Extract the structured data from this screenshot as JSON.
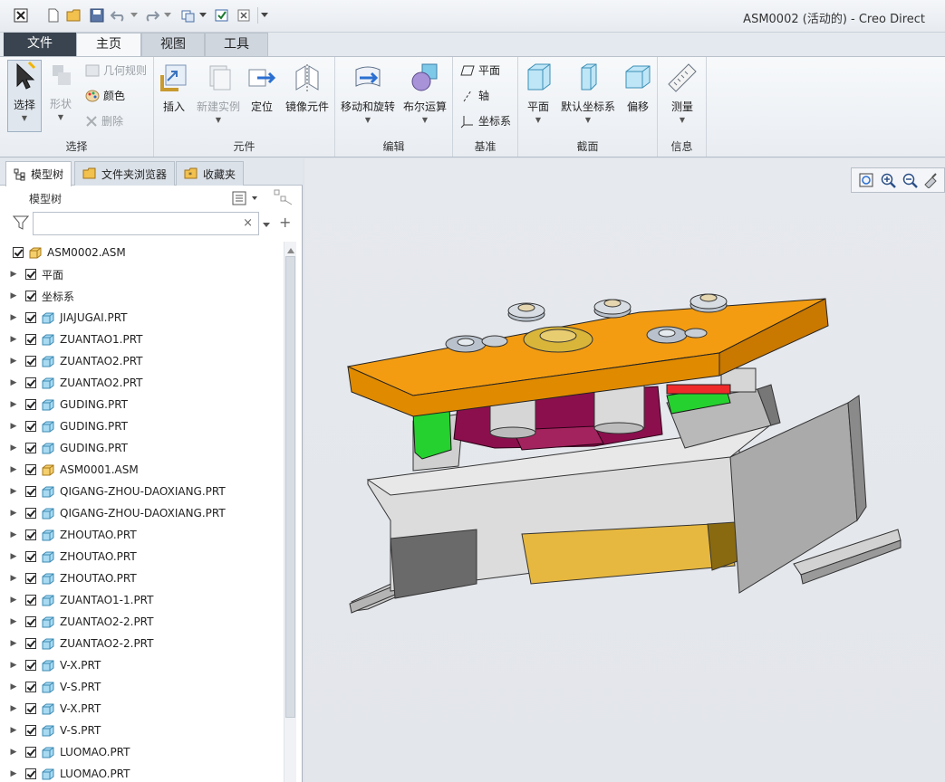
{
  "window": {
    "title": "ASM0002 (活动的) - Creo Direct"
  },
  "quick_access": [
    "close-app-icon",
    "new-icon",
    "open-icon",
    "save-icon",
    "undo-icon",
    "redo-icon",
    "regenerate-icon",
    "window-icon",
    "close-window-icon",
    "customize-icon"
  ],
  "ribbon": {
    "tabs": [
      {
        "label": "文件"
      },
      {
        "label": "主页"
      },
      {
        "label": "视图"
      },
      {
        "label": "工具"
      }
    ],
    "groups": {
      "select": {
        "label": "选择",
        "select_btn": "选择",
        "shape_btn": "形状",
        "geom_rule": "几何规则",
        "color": "颜色",
        "delete": "删除"
      },
      "component": {
        "label": "元件",
        "insert": "插入",
        "new_instance": "新建实例",
        "locate": "定位",
        "mirror": "镜像元件"
      },
      "edit": {
        "label": "编辑",
        "move_rotate": "移动和旋转",
        "boolean": "布尔运算"
      },
      "datum": {
        "label": "基准",
        "plane": "平面",
        "axis": "轴",
        "csys": "坐标系"
      },
      "section": {
        "label": "截面",
        "plane": "平面",
        "default_csys": "默认坐标系",
        "offset": "偏移"
      },
      "info": {
        "label": "信息",
        "measure": "测量"
      }
    }
  },
  "panel": {
    "tabs": [
      {
        "label": "模型树"
      },
      {
        "label": "文件夹浏览器"
      },
      {
        "label": "收藏夹"
      }
    ],
    "tree_title": "模型树",
    "search": {
      "value": "",
      "placeholder": ""
    },
    "tree": [
      {
        "label": "ASM0002.ASM",
        "type": "asm",
        "root": true
      },
      {
        "label": "平面",
        "type": "folder"
      },
      {
        "label": "坐标系",
        "type": "folder"
      },
      {
        "label": "JIAJUGAI.PRT",
        "type": "prt"
      },
      {
        "label": "ZUANTAO1.PRT",
        "type": "prt"
      },
      {
        "label": "ZUANTAO2.PRT",
        "type": "prt"
      },
      {
        "label": "ZUANTAO2.PRT",
        "type": "prt"
      },
      {
        "label": "GUDING.PRT",
        "type": "prt"
      },
      {
        "label": "GUDING.PRT",
        "type": "prt"
      },
      {
        "label": "GUDING.PRT",
        "type": "prt"
      },
      {
        "label": "ASM0001.ASM",
        "type": "asm"
      },
      {
        "label": "QIGANG-ZHOU-DAOXIANG.PRT",
        "type": "prt"
      },
      {
        "label": "QIGANG-ZHOU-DAOXIANG.PRT",
        "type": "prt"
      },
      {
        "label": "ZHOUTAO.PRT",
        "type": "prt"
      },
      {
        "label": "ZHOUTAO.PRT",
        "type": "prt"
      },
      {
        "label": "ZHOUTAO.PRT",
        "type": "prt"
      },
      {
        "label": "ZUANTAO1-1.PRT",
        "type": "prt"
      },
      {
        "label": "ZUANTAO2-2.PRT",
        "type": "prt"
      },
      {
        "label": "ZUANTAO2-2.PRT",
        "type": "prt"
      },
      {
        "label": "V-X.PRT",
        "type": "prt"
      },
      {
        "label": "V-S.PRT",
        "type": "prt"
      },
      {
        "label": "V-X.PRT",
        "type": "prt"
      },
      {
        "label": "V-S.PRT",
        "type": "prt"
      },
      {
        "label": "LUOMAO.PRT",
        "type": "prt"
      },
      {
        "label": "LUOMAO.PRT",
        "type": "prt"
      }
    ]
  },
  "view_toolbar": [
    "zoom-fit-icon",
    "zoom-in-icon",
    "zoom-out-icon",
    "orient-icon"
  ],
  "colors": {
    "plate_orange": "#f39c12",
    "fixture_gray": "#d4d4d4",
    "magenta_part": "#8b0f4d",
    "green_part": "#25d12e",
    "yellow_block": "#e7b83f"
  }
}
